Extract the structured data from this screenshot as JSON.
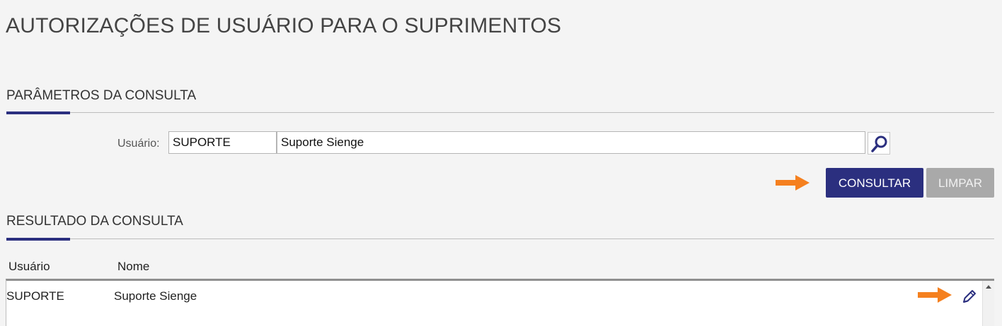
{
  "page": {
    "title": "AUTORIZAÇÕES DE USUÁRIO PARA O SUPRIMENTOS"
  },
  "params": {
    "heading": "PARÂMETROS DA CONSULTA",
    "user_label": "Usuário:",
    "user_code": "SUPORTE",
    "user_name": "Suporte Sienge",
    "lookup_icon": "search-icon"
  },
  "actions": {
    "consultar_label": "CONSULTAR",
    "limpar_label": "LIMPAR"
  },
  "results": {
    "heading": "RESULTADO DA CONSULTA",
    "columns": [
      "Usuário",
      "Nome"
    ],
    "rows": [
      {
        "usuario": "SUPORTE",
        "nome": "Suporte Sienge",
        "action_icon": "pencil-edit-icon"
      }
    ]
  },
  "colors": {
    "accent": "#2b2f7f",
    "disabled": "#a9a9a9",
    "annotation_arrow": "#f5801f"
  }
}
